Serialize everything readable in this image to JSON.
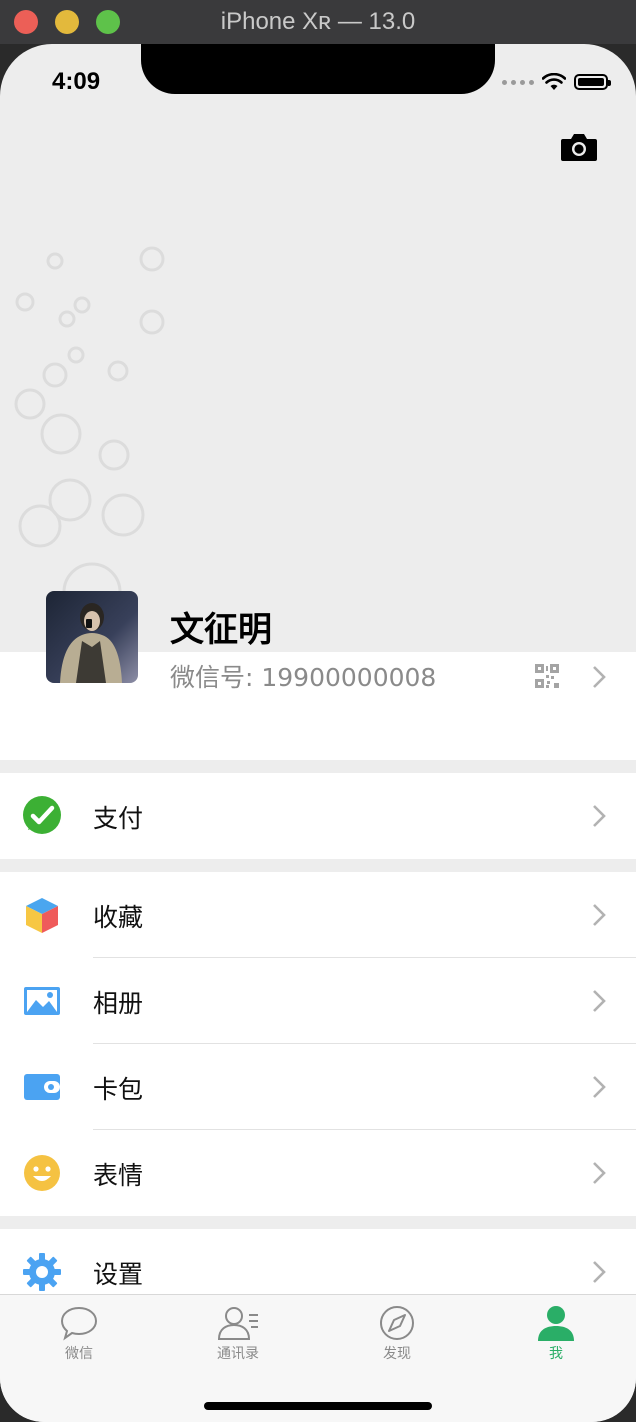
{
  "window": {
    "title": "iPhone Xʀ — 13.0"
  },
  "status_bar": {
    "time": "4:09"
  },
  "profile": {
    "nickname": "文征明",
    "wechat_id": "微信号: 19900000008",
    "icons": [
      "camera-icon",
      "qr-code-icon",
      "chevron-right-icon"
    ]
  },
  "menu": {
    "pay": {
      "label": "支付",
      "icon": "wechat-pay-icon",
      "color": "#3cb034"
    },
    "favorites": {
      "label": "收藏",
      "icon": "cube-icon"
    },
    "album": {
      "label": "相册",
      "icon": "image-icon",
      "color": "#4ba3f2"
    },
    "cards": {
      "label": "卡包",
      "icon": "wallet-icon",
      "color": "#4ba3f2"
    },
    "stickers": {
      "label": "表情",
      "icon": "smiley-icon",
      "color": "#f5c242"
    },
    "settings": {
      "label": "设置",
      "icon": "gear-icon",
      "color": "#4ba3f2"
    }
  },
  "tabbar": {
    "tabs": [
      {
        "label": "微信",
        "icon": "chat-bubble-icon",
        "active": false
      },
      {
        "label": "通讯录",
        "icon": "contacts-icon",
        "active": false
      },
      {
        "label": "发现",
        "icon": "compass-icon",
        "active": false
      },
      {
        "label": "我",
        "icon": "person-icon",
        "active": true
      }
    ],
    "active_color": "#2aae67"
  }
}
